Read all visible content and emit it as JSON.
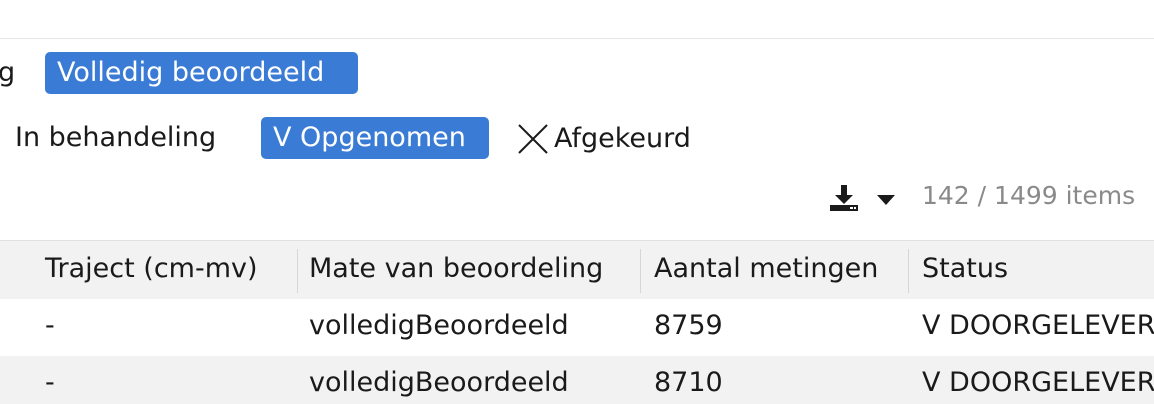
{
  "filters": {
    "row1": {
      "cutoff_text": "g",
      "selected_chip": "Volledig beoordeeld"
    },
    "row2": {
      "option_behandeling": "In behandeling",
      "selected_chip": "V Opgenomen",
      "option_afgekeurd": "Afgekeurd"
    }
  },
  "toolbar": {
    "download_icon": "download-icon",
    "caret_icon": "caret-down-icon",
    "items_count": "142 / 1499 items"
  },
  "table": {
    "columns": [
      "Traject (cm-mv)",
      "Mate van beoordeling",
      "Aantal metingen",
      "Status"
    ],
    "rows": [
      [
        "-",
        "volledigBeoordeeld",
        "8759",
        "V DOORGELEVERD"
      ],
      [
        "-",
        "volledigBeoordeeld",
        "8710",
        "V DOORGELEVERD"
      ]
    ]
  },
  "colors": {
    "accent": "#3a7bd5",
    "muted_text": "#8a8a8a",
    "header_bg": "#f2f2f2"
  }
}
